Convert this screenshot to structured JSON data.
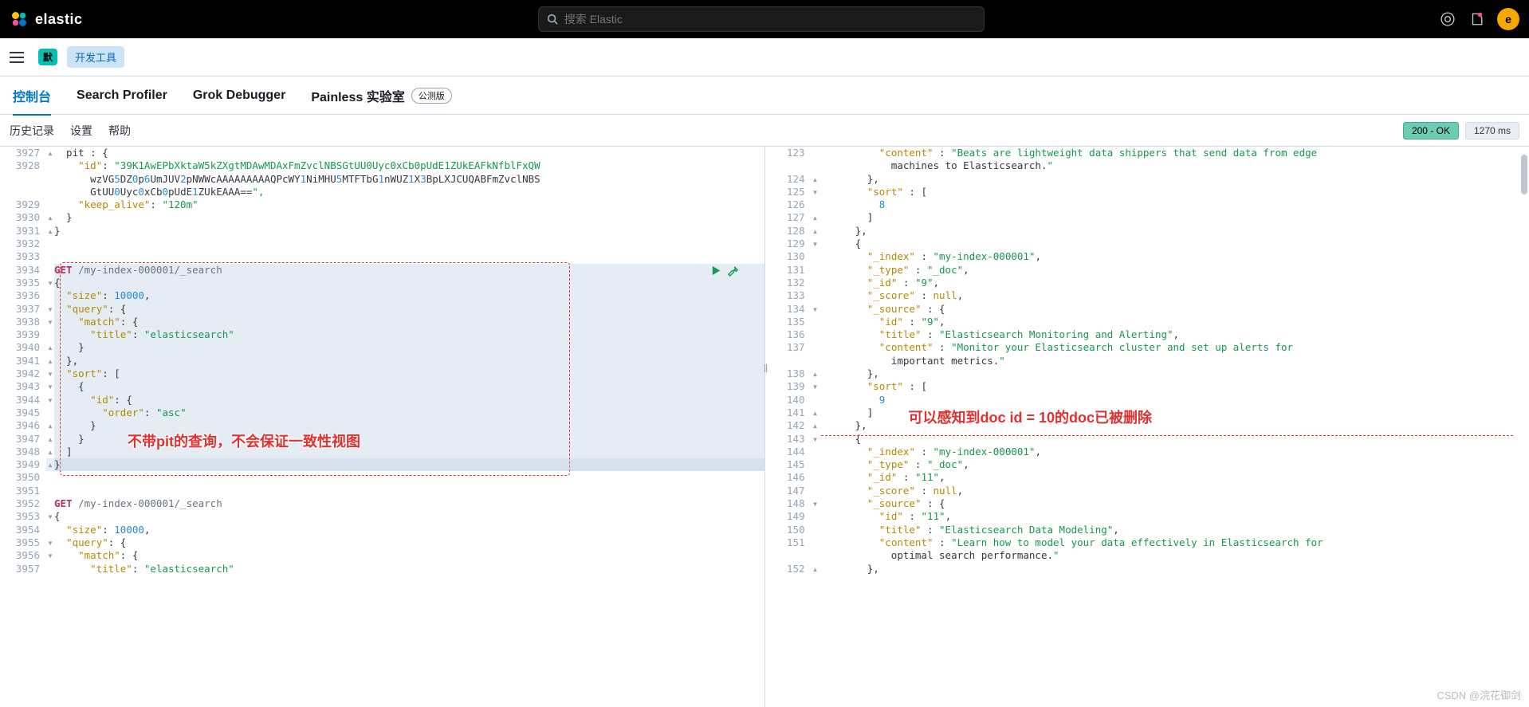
{
  "header": {
    "logo_text": "elastic",
    "search_placeholder": "搜索 Elastic",
    "avatar_letter": "e"
  },
  "subheader": {
    "badge1": "默",
    "badge2": "开发工具"
  },
  "tabs": {
    "t1": "控制台",
    "t2": "Search Profiler",
    "t3": "Grok Debugger",
    "t4": "Painless 实验室",
    "beta": "公测版"
  },
  "toolbar": {
    "history": "历史记录",
    "settings": "设置",
    "help": "帮助",
    "status": "200 - OK",
    "time": "1270 ms"
  },
  "left_lines": [
    {
      "n": "3927",
      "f": "^",
      "t": "  pit : {"
    },
    {
      "n": "3928",
      "f": "",
      "t": "    \"id\": \"39K1AwEPbXktaW5kZXgtMDAwMDAxFmZvclNBSGtUU0Uyc0xCb0pUdE1ZUkEAFkNfblFxQW"
    },
    {
      "n": "",
      "f": "",
      "t": "      wzVG5DZ0p6UmJUV2pNWWcAAAAAAAAAQPcWY1NiMHU5MTFTbG1nWUZ1X3BpLXJCUQABFmZvclNBS"
    },
    {
      "n": "",
      "f": "",
      "t": "      GtUU0Uyc0xCb0pUdE1ZUkEAAA==\","
    },
    {
      "n": "3929",
      "f": "",
      "t": "    \"keep_alive\": \"120m\""
    },
    {
      "n": "3930",
      "f": "^",
      "t": "  }"
    },
    {
      "n": "3931",
      "f": "^",
      "t": "}"
    },
    {
      "n": "3932",
      "f": "",
      "t": ""
    },
    {
      "n": "3933",
      "f": "",
      "t": ""
    },
    {
      "n": "3934",
      "f": "",
      "t": "GET /my-index-000001/_search",
      "sel": true
    },
    {
      "n": "3935",
      "f": "v",
      "t": "{",
      "sel": true
    },
    {
      "n": "3936",
      "f": "",
      "t": "  \"size\": 10000,",
      "sel": true
    },
    {
      "n": "3937",
      "f": "v",
      "t": "  \"query\": {",
      "sel": true
    },
    {
      "n": "3938",
      "f": "v",
      "t": "    \"match\": {",
      "sel": true
    },
    {
      "n": "3939",
      "f": "",
      "t": "      \"title\": \"elasticsearch\"",
      "sel": true
    },
    {
      "n": "3940",
      "f": "^",
      "t": "    }",
      "sel": true
    },
    {
      "n": "3941",
      "f": "^",
      "t": "  },",
      "sel": true
    },
    {
      "n": "3942",
      "f": "v",
      "t": "  \"sort\": [",
      "sel": true
    },
    {
      "n": "3943",
      "f": "v",
      "t": "    {",
      "sel": true
    },
    {
      "n": "3944",
      "f": "v",
      "t": "      \"id\": {",
      "sel": true
    },
    {
      "n": "3945",
      "f": "",
      "t": "        \"order\": \"asc\"",
      "sel": true
    },
    {
      "n": "3946",
      "f": "^",
      "t": "      }",
      "sel": true
    },
    {
      "n": "3947",
      "f": "^",
      "t": "    }",
      "sel": true
    },
    {
      "n": "3948",
      "f": "^",
      "t": "  ]",
      "sel": true
    },
    {
      "n": "3949",
      "f": "^",
      "t": "}",
      "sel": true,
      "cur": true
    },
    {
      "n": "3950",
      "f": "",
      "t": ""
    },
    {
      "n": "3951",
      "f": "",
      "t": ""
    },
    {
      "n": "3952",
      "f": "",
      "t": "GET /my-index-000001/_search"
    },
    {
      "n": "3953",
      "f": "v",
      "t": "{"
    },
    {
      "n": "3954",
      "f": "",
      "t": "  \"size\": 10000,"
    },
    {
      "n": "3955",
      "f": "v",
      "t": "  \"query\": {"
    },
    {
      "n": "3956",
      "f": "v",
      "t": "    \"match\": {"
    },
    {
      "n": "3957",
      "f": "",
      "t": "      \"title\": \"elasticsearch\""
    }
  ],
  "right_lines": [
    {
      "n": "123",
      "f": "",
      "t": "          \"content\" : \"Beats are lightweight data shippers that send data from edge"
    },
    {
      "n": "",
      "f": "",
      "t": "            machines to Elasticsearch.\""
    },
    {
      "n": "124",
      "f": "^",
      "t": "        },"
    },
    {
      "n": "125",
      "f": "v",
      "t": "        \"sort\" : ["
    },
    {
      "n": "126",
      "f": "",
      "t": "          8"
    },
    {
      "n": "127",
      "f": "^",
      "t": "        ]"
    },
    {
      "n": "128",
      "f": "^",
      "t": "      },"
    },
    {
      "n": "129",
      "f": "v",
      "t": "      {"
    },
    {
      "n": "130",
      "f": "",
      "t": "        \"_index\" : \"my-index-000001\","
    },
    {
      "n": "131",
      "f": "",
      "t": "        \"_type\" : \"_doc\","
    },
    {
      "n": "132",
      "f": "",
      "t": "        \"_id\" : \"9\","
    },
    {
      "n": "133",
      "f": "",
      "t": "        \"_score\" : null,"
    },
    {
      "n": "134",
      "f": "v",
      "t": "        \"_source\" : {"
    },
    {
      "n": "135",
      "f": "",
      "t": "          \"id\" : \"9\","
    },
    {
      "n": "136",
      "f": "",
      "t": "          \"title\" : \"Elasticsearch Monitoring and Alerting\","
    },
    {
      "n": "137",
      "f": "",
      "t": "          \"content\" : \"Monitor your Elasticsearch cluster and set up alerts for"
    },
    {
      "n": "",
      "f": "",
      "t": "            important metrics.\""
    },
    {
      "n": "138",
      "f": "^",
      "t": "        },"
    },
    {
      "n": "139",
      "f": "v",
      "t": "        \"sort\" : ["
    },
    {
      "n": "140",
      "f": "",
      "t": "          9"
    },
    {
      "n": "141",
      "f": "^",
      "t": "        ]"
    },
    {
      "n": "142",
      "f": "^",
      "t": "      },"
    },
    {
      "n": "143",
      "f": "v",
      "t": "      {"
    },
    {
      "n": "144",
      "f": "",
      "t": "        \"_index\" : \"my-index-000001\","
    },
    {
      "n": "145",
      "f": "",
      "t": "        \"_type\" : \"_doc\","
    },
    {
      "n": "146",
      "f": "",
      "t": "        \"_id\" : \"11\","
    },
    {
      "n": "147",
      "f": "",
      "t": "        \"_score\" : null,"
    },
    {
      "n": "148",
      "f": "v",
      "t": "        \"_source\" : {"
    },
    {
      "n": "149",
      "f": "",
      "t": "          \"id\" : \"11\","
    },
    {
      "n": "150",
      "f": "",
      "t": "          \"title\" : \"Elasticsearch Data Modeling\","
    },
    {
      "n": "151",
      "f": "",
      "t": "          \"content\" : \"Learn how to model your data effectively in Elasticsearch for"
    },
    {
      "n": "",
      "f": "",
      "t": "            optimal search performance.\""
    },
    {
      "n": "152",
      "f": "^",
      "t": "        },"
    }
  ],
  "annot": {
    "left": "不带pit的查询，不会保证一致性视图",
    "right": "可以感知到doc id = 10的doc已被删除"
  },
  "watermark": "CSDN @浣花御剑"
}
